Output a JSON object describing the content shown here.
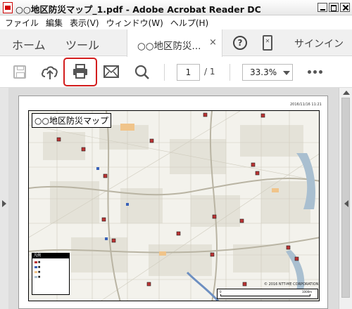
{
  "window": {
    "title": "○○地区防災マップ_1.pdf - Adobe Acrobat Reader DC"
  },
  "menu": [
    "ファイル",
    "編集",
    "表示(V)",
    "ウィンドウ(W)",
    "ヘルプ(H)"
  ],
  "tabs": {
    "home": "ホーム",
    "tools": "ツール",
    "document": "○○地区防災...",
    "close": "×",
    "signin": "サインイン"
  },
  "toolbar": {
    "page_current": "1",
    "page_total": "/ 1",
    "zoom": "33.3%"
  },
  "icons": [
    "save-icon",
    "upload-icon",
    "print-icon",
    "email-icon",
    "search-icon",
    "help-icon",
    "phone-icon",
    "more-icon"
  ],
  "highlight_color": "#d31d1d",
  "document": {
    "date": "2016/11/16 11:21",
    "map_title": "○○地区防災マップ",
    "legend_title": "凡例",
    "copyright": "© 2016 NTT-ME CORPORATION",
    "scale_start": "0",
    "scale_end": "1000m"
  }
}
